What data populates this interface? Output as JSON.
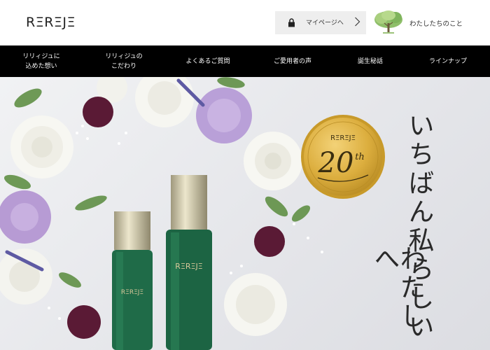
{
  "header": {
    "logo": "RΞRΞJΞ",
    "mypage_label": "マイページへ",
    "about_label": "わたしたちのこと"
  },
  "nav": {
    "items": [
      {
        "line1": "リリィジュに",
        "line2": "込めた想い"
      },
      {
        "line1": "リリィジュの",
        "line2": "こだわり"
      },
      {
        "line1": "よくあるご質問",
        "line2": ""
      },
      {
        "line1": "ご愛用者の声",
        "line2": ""
      },
      {
        "line1": "誕生秘話",
        "line2": ""
      },
      {
        "line1": "ラインナップ",
        "line2": ""
      }
    ]
  },
  "hero": {
    "headline_col1": "いちばん私らしい",
    "headline_col2": "わたしへ",
    "badge_logo": "RΞRΞJΞ",
    "badge_number": "20",
    "badge_suffix": "th",
    "bottle_label": "RΞRΞJΞ"
  },
  "colors": {
    "nav_bg": "#000000",
    "bottle_green": "#1f6b48",
    "gold": "#d9ad3c"
  }
}
